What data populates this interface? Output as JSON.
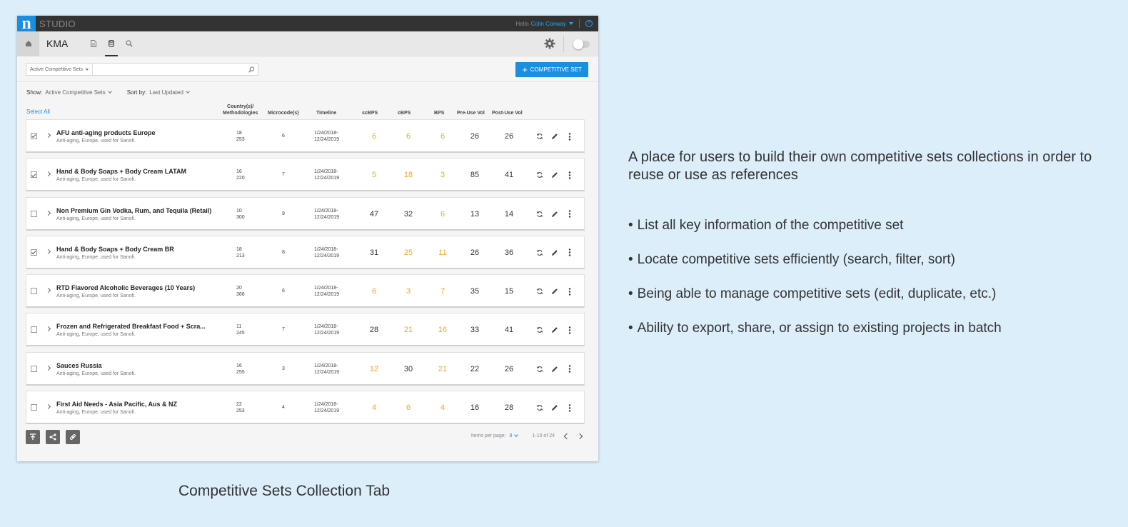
{
  "app": {
    "brand": "STUDIO",
    "greeting": "Hello",
    "user": "Colin Conway",
    "help": "?"
  },
  "nav": {
    "title": "KMA"
  },
  "filter": {
    "dropdown": "Active Competitive Sets",
    "search_placeholder": "",
    "add_button": "COMPETITIVE SET"
  },
  "sort": {
    "show_label": "Show:",
    "show_value": "Active Competitive Sets",
    "sort_label": "Sort by:",
    "sort_value": "Last Updated"
  },
  "table": {
    "select_all": "Select All",
    "columns": {
      "country_line1": "Country(s)/",
      "country_line2": "Methodologies",
      "microcode": "Microcode(s)",
      "timeline": "Timeline",
      "scbps": "scBPS",
      "cbps": "cBPS",
      "bps": "BPS",
      "pre": "Pre-Use Vol",
      "post": "Post-Use Vol"
    },
    "rows": [
      {
        "name": "AFU anti-aging products Europe",
        "sub": "Anti-aging, Europe, used for Sanofi.",
        "checked": true,
        "country": "18",
        "methodologies": "253",
        "microcode": "6",
        "time1": "1/24/2018-",
        "time2": "12/24/2019",
        "scbps": "6",
        "cbps": "6",
        "bps": "6",
        "pre": "26",
        "post": "26",
        "hl": [
          true,
          true,
          true
        ]
      },
      {
        "name": "Hand & Body Soaps + Body Cream LATAM",
        "sub": "Anti-aging, Europe, used for Sanofi.",
        "checked": true,
        "country": "16",
        "methodologies": "220",
        "microcode": "7",
        "time1": "1/24/2018-",
        "time2": "12/24/2019",
        "scbps": "5",
        "cbps": "18",
        "bps": "3",
        "pre": "85",
        "post": "41",
        "hl": [
          true,
          true,
          true
        ]
      },
      {
        "name": "Non Premium Gin Vodka, Rum, and Tequila (Retail)",
        "sub": "Anti-aging, Europe, used for Sanofi.",
        "checked": false,
        "country": "10",
        "methodologies": "300",
        "microcode": "9",
        "time1": "1/24/2018-",
        "time2": "12/24/2019",
        "scbps": "47",
        "cbps": "32",
        "bps": "6",
        "pre": "13",
        "post": "14",
        "hl": [
          false,
          false,
          true
        ]
      },
      {
        "name": "Hand & Body Soaps + Body Cream BR",
        "sub": "Anti-aging, Europe, used for Sanofi.",
        "checked": true,
        "country": "18",
        "methodologies": "213",
        "microcode": "8",
        "time1": "1/24/2018-",
        "time2": "12/24/2019",
        "scbps": "31",
        "cbps": "25",
        "bps": "11",
        "pre": "26",
        "post": "36",
        "hl": [
          false,
          true,
          true
        ]
      },
      {
        "name": "RTD Flavored Alcoholic Beverages (10 Years)",
        "sub": "Anti-aging, Europe, used for Sanofi.",
        "checked": false,
        "country": "20",
        "methodologies": "366",
        "microcode": "6",
        "time1": "1/24/2018-",
        "time2": "12/24/2019",
        "scbps": "6",
        "cbps": "3",
        "bps": "7",
        "pre": "35",
        "post": "15",
        "hl": [
          true,
          true,
          true
        ]
      },
      {
        "name": "Frozen and Refrigerated Breakfast Food + Scra...",
        "sub": "Anti-aging, Europe, used for Sanofi.",
        "checked": false,
        "country": "11",
        "methodologies": "245",
        "microcode": "7",
        "time1": "1/24/2018-",
        "time2": "12/24/2019",
        "scbps": "28",
        "cbps": "21",
        "bps": "16",
        "pre": "33",
        "post": "41",
        "hl": [
          false,
          true,
          true
        ]
      },
      {
        "name": "Sauces Russia",
        "sub": "Anti-aging, Europe, used for Sanofi.",
        "checked": false,
        "country": "16",
        "methodologies": "255",
        "microcode": "3",
        "time1": "1/24/2018-",
        "time2": "12/24/2019",
        "scbps": "12",
        "cbps": "30",
        "bps": "21",
        "pre": "22",
        "post": "26",
        "hl": [
          true,
          false,
          true
        ]
      },
      {
        "name": "First Aid Needs - Asia Pacific, Aus & NZ",
        "sub": "Anti-aging, Europe, used for Sanofi.",
        "checked": false,
        "country": "22",
        "methodologies": "253",
        "microcode": "4",
        "time1": "1/24/2018-",
        "time2": "12/24/2019",
        "scbps": "4",
        "cbps": "6",
        "bps": "4",
        "pre": "16",
        "post": "28",
        "hl": [
          true,
          true,
          true
        ]
      }
    ]
  },
  "pagination": {
    "items_label": "Items per page:",
    "items_value": "8",
    "range": "1-10 of 24"
  },
  "colors": {
    "accent": "#1a8fe0",
    "highlight": "#f5a623",
    "normal": "#333333"
  },
  "caption": "Competitive Sets Collection Tab",
  "description": {
    "heading": "A place for users to build their own competitive sets collections in order to reuse or use as references",
    "bullets": [
      "List all key information of the competitive set",
      "Locate competitive sets efficiently (search, filter, sort)",
      "Being able to manage competitive sets (edit, duplicate, etc.)",
      "Ability to export, share, or assign to existing projects in batch"
    ]
  }
}
